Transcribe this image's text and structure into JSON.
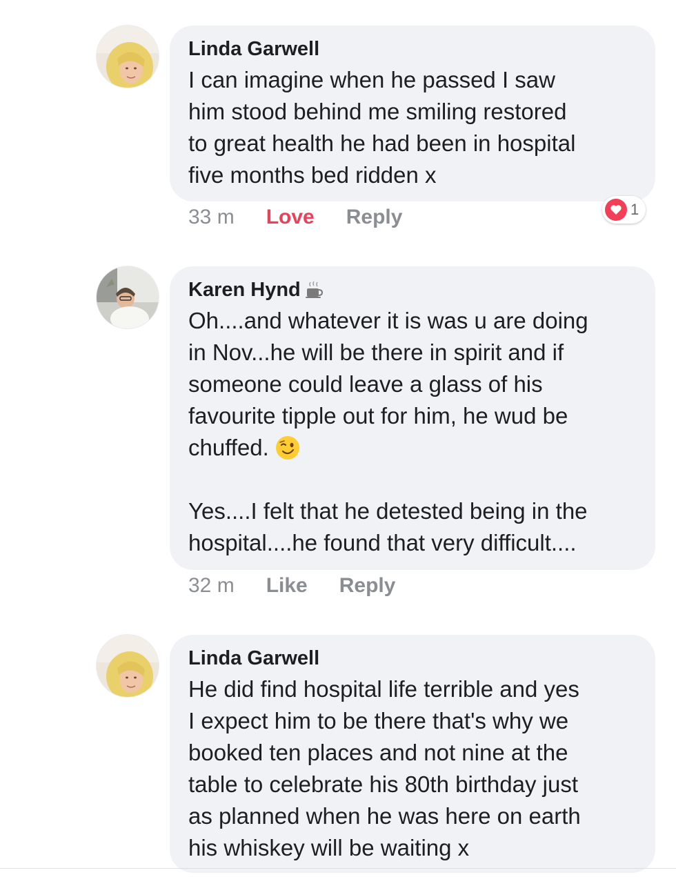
{
  "comments": [
    {
      "author": "Linda Garwell",
      "text": "I can imagine when he passed I saw\nhim stood behind me smiling restored\nto great health  he had been in hospital\nfive months bed ridden x",
      "time": "33 m",
      "react_label": "Love",
      "reply_label": "Reply",
      "reaction": {
        "icon": "heart-icon",
        "count": "1",
        "color": "#f33e58"
      }
    },
    {
      "author": "Karen Hynd",
      "author_badge_icon": "coffee-cup-icon",
      "text_part1": "Oh....and whatever it is was u are doing\nin Nov...he will be there in spirit and if\nsomeone could leave a glass of his\nfavourite tipple out for him, he wud be\nchuffed.",
      "emoji": "winking-face-icon",
      "text_part2": "Yes....I felt that he detested being in the\nhospital....he found that very difficult....",
      "time": "32 m",
      "react_label": "Like",
      "reply_label": "Reply"
    },
    {
      "author": "Linda Garwell",
      "text": "He did find hospital life terrible and yes\nI expect him to be there that's why we\nbooked ten places and not nine at the\ntable to celebrate his 80th birthday just\nas planned when he was here on earth\nhis whiskey will be waiting x"
    }
  ],
  "colors": {
    "bubble": "#f0f2f5",
    "love": "#e8415a",
    "meta": "#8a8d91",
    "text": "#1c1e21"
  }
}
